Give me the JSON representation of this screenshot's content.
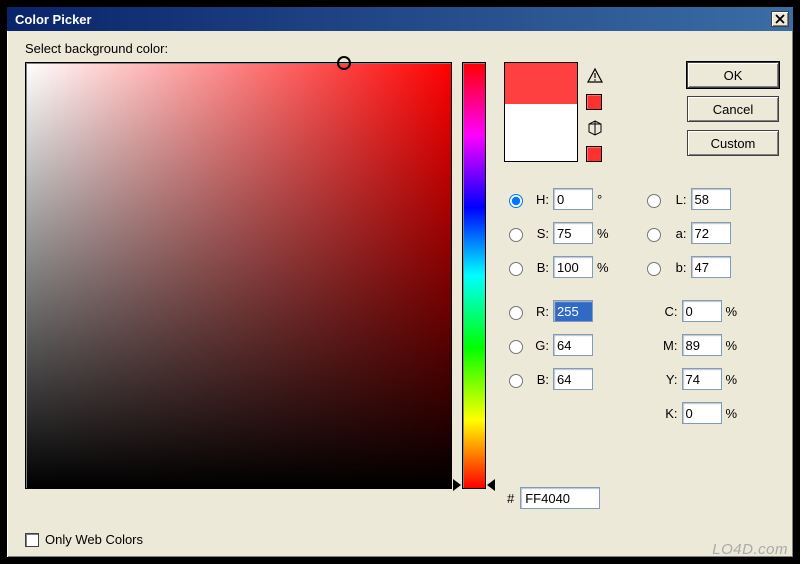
{
  "window": {
    "title": "Color Picker"
  },
  "label": "Select background color:",
  "buttons": {
    "ok": "OK",
    "cancel": "Cancel",
    "custom": "Custom"
  },
  "preview": {
    "new_color": "#ff4040",
    "old_color": "#ffffff",
    "warn_swatch": "#ff3030",
    "cube_swatch": "#ff3030"
  },
  "fields": {
    "h": {
      "label": "H:",
      "value": "0",
      "unit": "°",
      "selected": true
    },
    "s": {
      "label": "S:",
      "value": "75",
      "unit": "%",
      "selected": false
    },
    "bb": {
      "label": "B:",
      "value": "100",
      "unit": "%",
      "selected": false
    },
    "l": {
      "label": "L:",
      "value": "58",
      "selected": false
    },
    "a": {
      "label": "a:",
      "value": "72",
      "selected": false
    },
    "b2": {
      "label": "b:",
      "value": "47",
      "selected": false
    },
    "r": {
      "label": "R:",
      "value": "255",
      "selected": false,
      "highlighted": true
    },
    "g": {
      "label": "G:",
      "value": "64",
      "selected": false
    },
    "bl": {
      "label": "B:",
      "value": "64",
      "selected": false
    },
    "c": {
      "label": "C:",
      "value": "0",
      "unit": "%"
    },
    "m": {
      "label": "M:",
      "value": "89",
      "unit": "%"
    },
    "y": {
      "label": "Y:",
      "value": "74",
      "unit": "%"
    },
    "k": {
      "label": "K:",
      "value": "0",
      "unit": "%"
    }
  },
  "hex": {
    "prefix": "#",
    "value": "FF4040"
  },
  "checkbox": {
    "label": "Only Web Colors",
    "checked": false
  },
  "watermark": "LO4D.com"
}
